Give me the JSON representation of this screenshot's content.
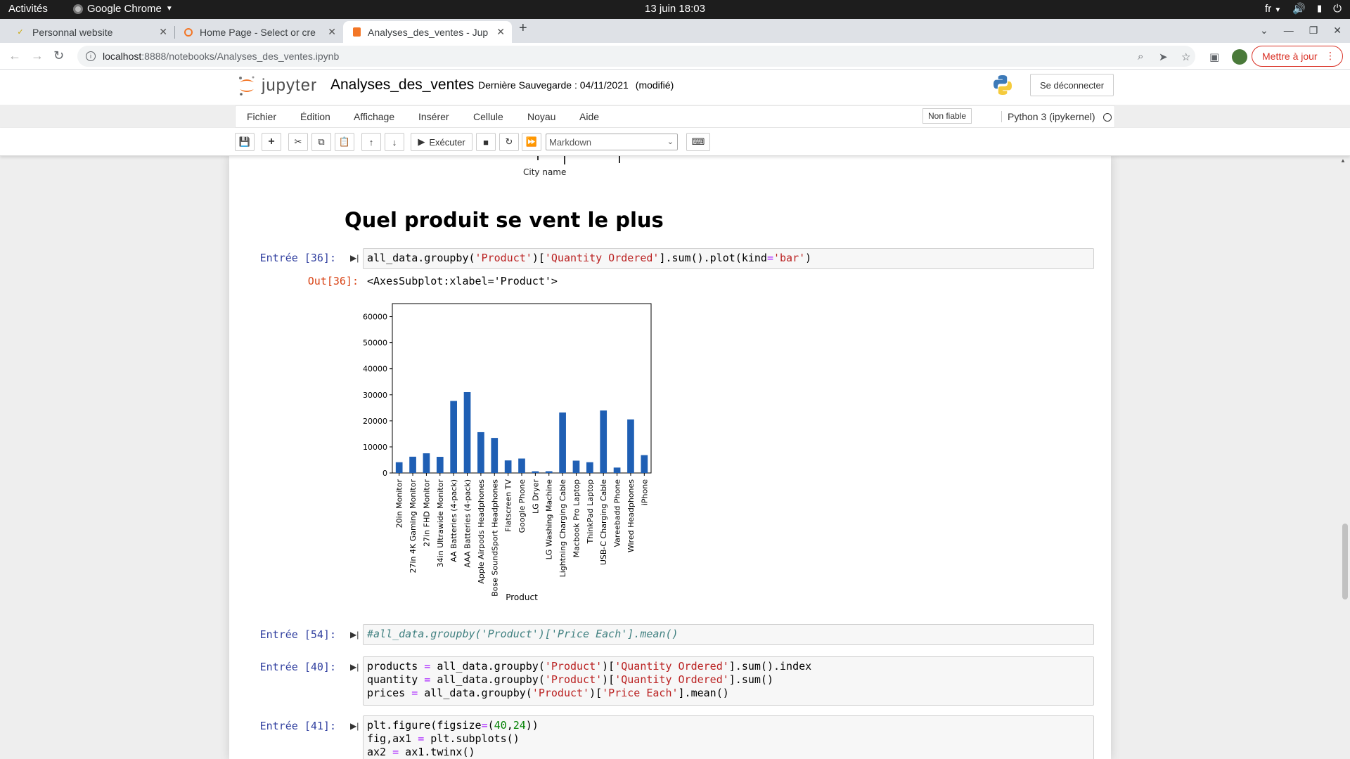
{
  "system": {
    "activities": "Activités",
    "app_name": "Google Chrome",
    "clock": "13 juin  18:03",
    "lang": "fr"
  },
  "browser": {
    "tabs": [
      {
        "title": "Personnal website",
        "active": false
      },
      {
        "title": "Home Page - Select or cre",
        "active": false
      },
      {
        "title": "Analyses_des_ventes - Jup",
        "active": true
      }
    ],
    "url_host": "localhost",
    "url_path": ":8888/notebooks/Analyses_des_ventes.ipynb",
    "update_label": "Mettre à jour"
  },
  "jupyter": {
    "logo_text": "jupyter",
    "notebook_name": "Analyses_des_ventes",
    "checkpoint": "Dernière Sauvegarde : 04/11/2021",
    "modified": "(modifié)",
    "logout_label": "Se déconnecter",
    "menu": [
      "Fichier",
      "Édition",
      "Affichage",
      "Insérer",
      "Cellule",
      "Noyau",
      "Aide"
    ],
    "trust_label": "Non fiable",
    "kernel_name": "Python 3 (ipykernel)",
    "run_label": "Exécuter",
    "cell_type": "Markdown"
  },
  "notebook": {
    "prev_output_axis_label": "City name",
    "heading": "Quel produit se vent le plus",
    "cells": [
      {
        "prompt": "Entrée [36]:"
      },
      {
        "prompt": "Entrée [54]:"
      },
      {
        "prompt": "Entrée [40]:"
      },
      {
        "prompt": "Entrée [41]:"
      }
    ],
    "out_prompt": "Out[36]:",
    "out_text": "<AxesSubplot:xlabel='Product'>"
  },
  "chart_data": {
    "type": "bar",
    "xlabel": "Product",
    "ylabel": "",
    "ylim": [
      0,
      65000
    ],
    "yticks": [
      0,
      10000,
      20000,
      30000,
      40000,
      50000,
      60000
    ],
    "color": "#1f5fb4",
    "categories": [
      "20in Monitor",
      "27in 4K Gaming Monitor",
      "27in FHD Monitor",
      "34in Ultrawide Monitor",
      "AA Batteries (4-pack)",
      "AAA Batteries (4-pack)",
      "Apple Airpods Headphones",
      "Bose SoundSport Headphones",
      "Flatscreen TV",
      "Google Phone",
      "LG Dryer",
      "LG Washing Machine",
      "Lightning Charging Cable",
      "Macbook Pro Laptop",
      "ThinkPad Laptop",
      "USB-C Charging Cable",
      "Vareebadd Phone",
      "Wired Headphones",
      "iPhone"
    ],
    "values": [
      4129,
      6244,
      7550,
      6199,
      27635,
      31017,
      15661,
      13457,
      4819,
      5532,
      646,
      666,
      23217,
      4728,
      4130,
      23975,
      2068,
      20557,
      6849
    ]
  }
}
